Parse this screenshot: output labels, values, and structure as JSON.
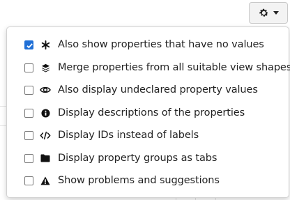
{
  "toolbar": {
    "settings_button_icon": "gear-icon",
    "settings_dropdown_icon": "caret-down-icon"
  },
  "menu": {
    "items": [
      {
        "label": "Also show properties that have no values",
        "checked": true,
        "icon": "asterisk-icon"
      },
      {
        "label": "Merge properties from all suitable view shapes",
        "checked": false,
        "icon": "layers-icon"
      },
      {
        "label": "Also display undeclared property values",
        "checked": false,
        "icon": "eye-icon"
      },
      {
        "label": "Display descriptions of the properties",
        "checked": false,
        "icon": "info-circle-icon"
      },
      {
        "label": "Display IDs instead of labels",
        "checked": false,
        "icon": "code-icon"
      },
      {
        "label": "Display property groups as tabs",
        "checked": false,
        "icon": "folder-icon"
      },
      {
        "label": "Show problems and suggestions",
        "checked": false,
        "icon": "warning-icon"
      }
    ]
  },
  "colors": {
    "checkbox_checked": "#1f6fd6",
    "text": "#222222",
    "icon": "#111111"
  }
}
